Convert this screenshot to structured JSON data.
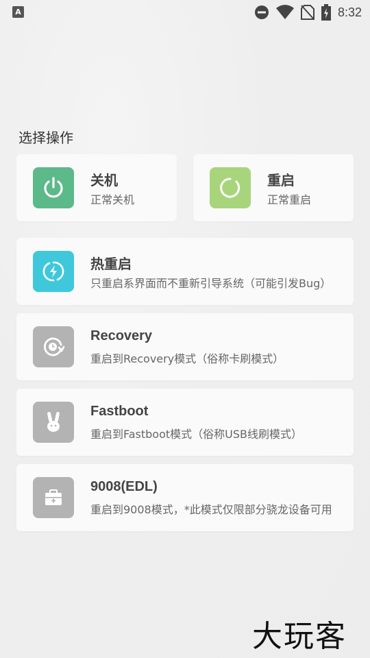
{
  "status_bar": {
    "left_icon": "A",
    "icons": [
      "do-not-disturb-icon",
      "wifi-icon",
      "no-sim-icon",
      "battery-charging-icon"
    ],
    "time": "8:32"
  },
  "section_title": "选择操作",
  "colors": {
    "power": "#5cb98a",
    "reboot": "#a8d57c",
    "hot_reboot": "#3fc8dc",
    "disabled": "#b3b3b3"
  },
  "actions": {
    "shutdown": {
      "title": "关机",
      "desc": "正常关机",
      "icon": "power-icon"
    },
    "reboot": {
      "title": "重启",
      "desc": "正常重启",
      "icon": "restart-icon"
    },
    "hot_reboot": {
      "title": "热重启",
      "desc": "只重启系界面而不重新引导系统（可能引发Bug）",
      "icon": "lightning-refresh-icon"
    },
    "recovery": {
      "title": "Recovery",
      "desc": "重启到Recovery模式（俗称卡刷模式）",
      "icon": "clock-refresh-icon"
    },
    "fastboot": {
      "title": "Fastboot",
      "desc": "重启到Fastboot模式（俗称USB线刷模式）",
      "icon": "bunny-icon"
    },
    "edl": {
      "title": "9008(EDL)",
      "desc": "重启到9008模式，*此模式仅限部分骁龙设备可用",
      "icon": "toolbox-icon"
    }
  },
  "watermark": "大玩客"
}
